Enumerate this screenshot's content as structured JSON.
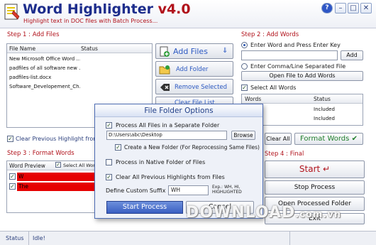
{
  "app": {
    "title": "Word Highlighter",
    "version": "v4.0",
    "subtitle": "Highlight text in DOC files with Batch Process..."
  },
  "window_buttons": {
    "help": "?",
    "minimize": "–",
    "maximize": "□",
    "close": "✕"
  },
  "step1": {
    "heading": "Step 1 : Add Files",
    "columns": [
      "File Name",
      "Status"
    ],
    "files": [
      "New Microsoft Office Word ...",
      "padfiles of all software new ...",
      "padfiles-list.docx",
      "Software_Developement_Ch..."
    ],
    "add_files_label": "Add Files",
    "add_files_arrow": "⇓",
    "add_folder_label": "Add Folder",
    "remove_selected_label": "Remove Selected",
    "clear_file_list_label": "Clear File List",
    "clear_previous_highlight_label": "Clear Previous Highlight from"
  },
  "step2": {
    "heading": "Step 2 : Add Words",
    "radio_enter_word": "Enter Word and Press Enter Key",
    "word_input_value": "",
    "add_button": "Add",
    "radio_comma_file": "Enter Comma/Line Separated File",
    "open_file_button": "Open File to Add Words",
    "select_all_words": "Select All Words",
    "columns": [
      "Words",
      "Status"
    ],
    "words": [
      {
        "word": "",
        "status": "Included"
      },
      {
        "word": "",
        "status": "Included"
      }
    ],
    "clear_all_button": "Clear All",
    "format_words_button": "Format Words",
    "format_words_check": "✔"
  },
  "step3": {
    "heading": "Step 3 : Format Words",
    "column_word_preview": "Word Preview",
    "select_all_label": "Select All Wor",
    "rows": [
      {
        "label": "W",
        "color": "#e60000"
      },
      {
        "label": "The",
        "color": "#e60000"
      }
    ]
  },
  "step4": {
    "heading": "Step 4 : Final",
    "start_button": "Start",
    "start_icon": "↵",
    "stop_button": "Stop Process",
    "open_folder_button": "Open Processed Folder",
    "exit_button": "Exit"
  },
  "dialog": {
    "title": "File Folder Options",
    "process_separate_label": "Process All Files in a Separate Folder",
    "path_value": "D:\\Users\\abc\\Desktop",
    "browse_button": "Browse",
    "create_new_folder_label": "Create a New Folder (For Reprocessing Same Files)",
    "process_native_label": "Process in Native Folder of Files",
    "clear_highlights_label": "Clear All Previous Highlights from Files",
    "suffix_label": "Define Custom Suffix",
    "suffix_value": "WH",
    "suffix_example": "Exp.: WH, HI, HIGHLIGHTED",
    "start_process_button": "Start Process",
    "cancel_button": "Cancel"
  },
  "status_bar": {
    "label": "Status",
    "value": "Idle!"
  },
  "watermark": {
    "main": "DOWNLOAD",
    "tld": ".com.vn"
  },
  "colors": {
    "title_blue": "#1d2d8c",
    "accent_red": "#b1121b",
    "highlight_red": "#e60000",
    "green": "#1e7d2a"
  }
}
